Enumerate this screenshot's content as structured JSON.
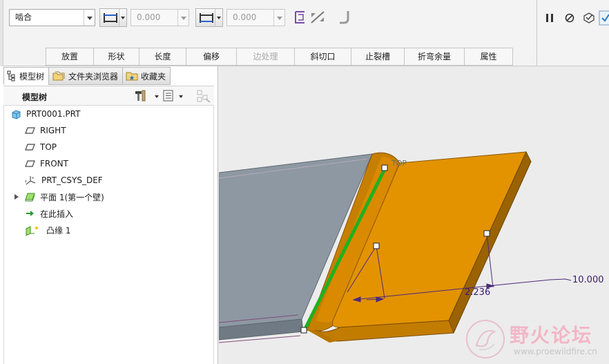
{
  "toolbar": {
    "type_select": "啮合",
    "offset1_value": "0.000",
    "offset2_value": "0.000"
  },
  "tabs": [
    {
      "label": "放置",
      "enabled": true
    },
    {
      "label": "形状",
      "enabled": true
    },
    {
      "label": "长度",
      "enabled": true
    },
    {
      "label": "偏移",
      "enabled": true
    },
    {
      "label": "边处理",
      "enabled": false
    },
    {
      "label": "斜切口",
      "enabled": true
    },
    {
      "label": "止裂槽",
      "enabled": true
    },
    {
      "label": "折弯余量",
      "enabled": true
    },
    {
      "label": "属性",
      "enabled": true
    }
  ],
  "panel": {
    "tabs": [
      {
        "label": "模型树",
        "icon": "model-tree-icon"
      },
      {
        "label": "文件夹浏览器",
        "icon": "folder-browser-icon"
      },
      {
        "label": "收藏夹",
        "icon": "favorites-icon"
      }
    ],
    "tree_title": "模型树",
    "items": [
      {
        "label": "PRT0001.PRT",
        "icon": "part-icon"
      },
      {
        "label": "RIGHT",
        "icon": "datum-plane-icon"
      },
      {
        "label": "TOP",
        "icon": "datum-plane-icon"
      },
      {
        "label": "FRONT",
        "icon": "datum-plane-icon"
      },
      {
        "label": "PRT_CSYS_DEF",
        "icon": "csys-icon"
      },
      {
        "label": "平面 1(第一个壁)",
        "icon": "planar-wall-icon"
      },
      {
        "label": "在此插入",
        "icon": "insert-here-arrow-icon"
      },
      {
        "label": "凸缘 1",
        "icon": "flange-icon"
      }
    ]
  },
  "viewport": {
    "top_label": "TOP",
    "dimension_1": "10.000",
    "dimension_2": "2.236"
  },
  "watermark": {
    "title": "野火论坛",
    "url": "www.proewildfire.cn"
  },
  "colors": {
    "flange_orange": "#e39300",
    "flange_edge": "#9a6200",
    "base_plate": "#8d98a3",
    "edge_green": "#22b01e",
    "dimension": "#3a1b6b"
  }
}
